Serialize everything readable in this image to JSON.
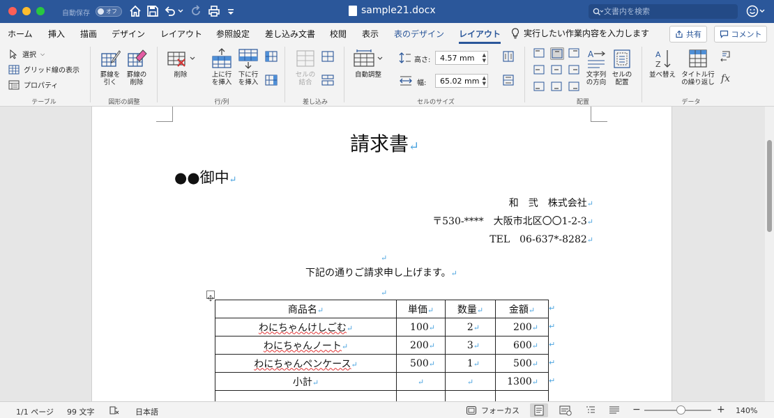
{
  "window": {
    "autosave_label": "自動保存",
    "autosave_state": "オフ",
    "doc_title": "sample21.docx",
    "search_placeholder": "文書内を検索"
  },
  "tabs": [
    {
      "label": "ホーム"
    },
    {
      "label": "挿入"
    },
    {
      "label": "描画"
    },
    {
      "label": "デザイン"
    },
    {
      "label": "レイアウト"
    },
    {
      "label": "参照設定"
    },
    {
      "label": "差し込み文書"
    },
    {
      "label": "校閲"
    },
    {
      "label": "表示"
    },
    {
      "label": "表のデザイン"
    },
    {
      "label": "レイアウト"
    }
  ],
  "tell_me": "実行したい作業内容を入力します",
  "share_label": "共有",
  "comment_label": "コメント",
  "ribbon": {
    "table": {
      "select": "選択",
      "gridlines": "グリッド線の表示",
      "properties": "プロパティ",
      "group": "テーブル"
    },
    "draw": {
      "draw_line1": "罫線を",
      "draw_line2": "引く",
      "erase_line1": "罫線の",
      "erase_line2": "削除",
      "group": "図形の調整"
    },
    "rows": {
      "delete": "削除",
      "ins_above1": "上に行",
      "ins_above2": "を挿入",
      "ins_below1": "下に行",
      "ins_below2": "を挿入",
      "group": "行/列"
    },
    "merge": {
      "merge1": "セルの",
      "merge2": "結合",
      "group": "差し込み"
    },
    "size": {
      "autofit": "自動調整",
      "height_label": "高さ:",
      "height_value": "4.57 mm",
      "width_label": "幅:",
      "width_value": "65.02 mm",
      "group": "セルのサイズ"
    },
    "align": {
      "text_dir1": "文字列",
      "text_dir2": "の方向",
      "margins1": "セルの",
      "margins2": "配置",
      "group": "配置"
    },
    "data": {
      "sort": "並べ替え",
      "repeat1": "タイトル行",
      "repeat2": "の繰り返し",
      "formula": "fx",
      "group": "データ"
    }
  },
  "document": {
    "title": "請求書",
    "recipient": "●●御中",
    "company": "和　弐　株式会社",
    "address": "〒530-****　大阪市北区〇〇1-2-3",
    "tel": "TEL　06-637*-8282",
    "intro": "下記の通りご請求申し上げます。",
    "table": {
      "headers": [
        "商品名",
        "単価",
        "数量",
        "金額"
      ],
      "rows": [
        [
          "わにちゃんけしごむ",
          "100",
          "2",
          "200"
        ],
        [
          "わにちゃんノート",
          "200",
          "3",
          "600"
        ],
        [
          "わにちゃんペンケース",
          "500",
          "1",
          "500"
        ],
        [
          "小計",
          "",
          "",
          "1300"
        ]
      ]
    }
  },
  "status": {
    "page": "1/1 ページ",
    "words": "99 文字",
    "language": "日本語",
    "focus": "フォーカス",
    "zoom": "140%"
  },
  "colors": {
    "accent": "#2b579a",
    "ribbon_bg": "#f3f3f3",
    "canvas_bg": "#e6e6e6"
  }
}
